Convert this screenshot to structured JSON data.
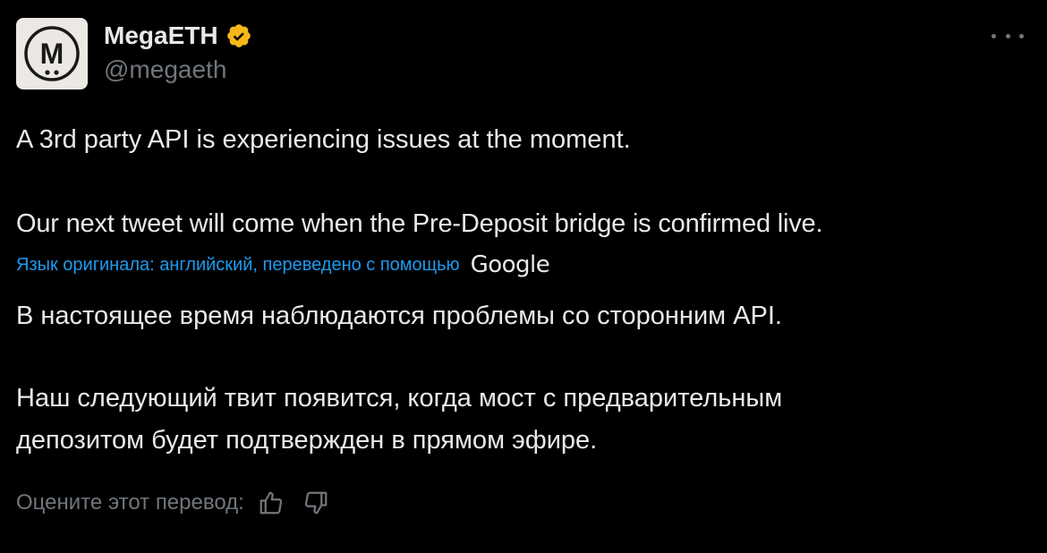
{
  "author": {
    "display_name": "MegaETH",
    "handle": "@megaeth",
    "avatar_letter": "M",
    "verified_icon": "verified-badge-icon",
    "verified_color": "#f5b819"
  },
  "menu_icon": "more-options-icon",
  "tweet": {
    "original_line_1": "A 3rd party API is experiencing issues at the moment.",
    "original_line_2": "Our next tweet will come when the Pre-Deposit bridge is confirmed live."
  },
  "translation": {
    "note": "Язык оригинала: английский, переведено с помощью",
    "provider": "Google",
    "line_1": "В настоящее время наблюдаются проблемы со сторонним API.",
    "line_2": "Наш следующий твит появится, когда мост с предварительным",
    "line_3": "депозитом будет подтвержден в прямом эфире.",
    "rate_label": "Оцените этот перевод:",
    "thumbs_up_icon": "thumbs-up-icon",
    "thumbs_down_icon": "thumbs-down-icon"
  },
  "colors": {
    "background": "#000000",
    "text": "#e7e9ea",
    "secondary": "#71767b",
    "link": "#1d9bf0"
  }
}
